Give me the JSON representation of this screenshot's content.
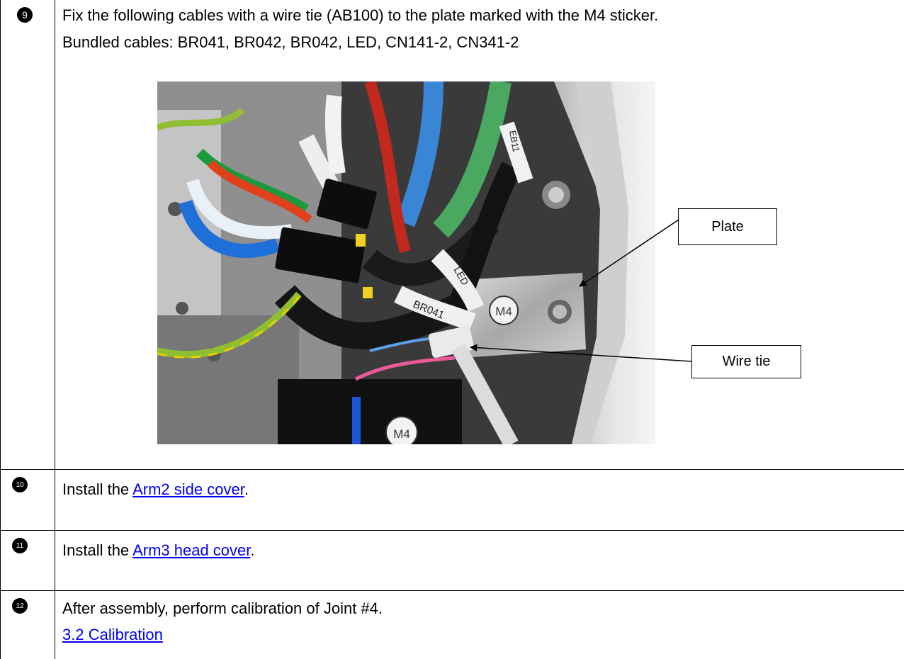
{
  "steps": [
    {
      "number": "9",
      "line1": "Fix the following cables with a wire tie (AB100) to the plate marked with the M4 sticker.",
      "line2": "Bundled cables: BR041, BR042, BR042, LED, CN141-2, CN341-2"
    },
    {
      "number": "10",
      "prefix": "Install the ",
      "link": "Arm2 side cover",
      "suffix": "."
    },
    {
      "number": "11",
      "prefix": "Install the ",
      "link": "Arm3 head cover",
      "suffix": "."
    },
    {
      "number": "12",
      "line1": "After assembly, perform calibration of Joint #4.",
      "link": "3.2 Calibration"
    }
  ],
  "figure": {
    "callout_plate": "Plate",
    "callout_wire_tie": "Wire tie",
    "sticker_m4_upper": "M4",
    "sticker_m4_lower": "M4",
    "tube_label_1": "LED",
    "tube_label_2": "BR041",
    "tube_label_3": "EB11"
  }
}
